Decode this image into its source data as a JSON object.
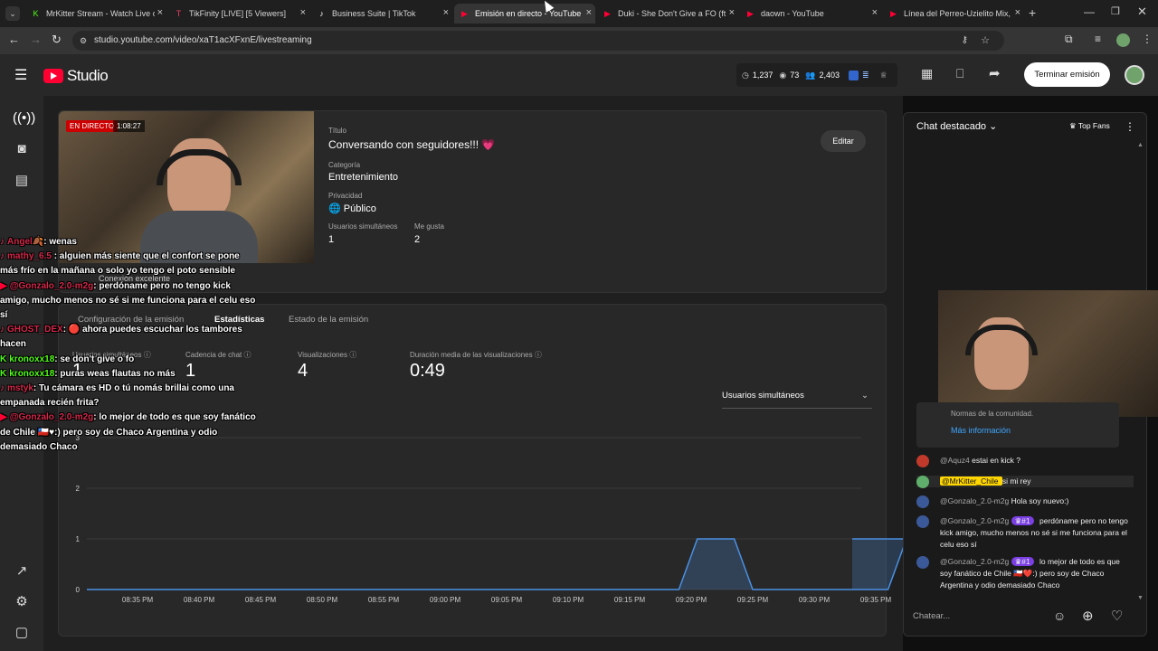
{
  "browser": {
    "tabs": [
      {
        "title": "MrKitter Stream - Watch Live o",
        "icon_color": "#53fc18",
        "icon": "K"
      },
      {
        "title": "TikFinity [LIVE] [5 Viewers]",
        "icon_color": "#e93c5e",
        "icon": "T"
      },
      {
        "title": "Business Suite | TikTok",
        "icon_color": "#ffffff",
        "icon": "♪"
      },
      {
        "title": "Emisión en directo - YouTube S",
        "icon_color": "#ff0033",
        "icon": "▶"
      },
      {
        "title": "Duki - She Don't Give a FO (ft.",
        "icon_color": "#ff0033",
        "icon": "▶"
      },
      {
        "title": "daown - YouTube",
        "icon_color": "#ff0033",
        "icon": "▶"
      },
      {
        "title": "Línea del Perreo-Uzielito Mix, V",
        "icon_color": "#ff0033",
        "icon": "▶"
      }
    ],
    "url": "studio.youtube.com/video/xaT1acXFxnE/livestreaming"
  },
  "header": {
    "logo_text": "Studio",
    "stats": {
      "likes": "1,237",
      "views": "73",
      "subs": "2,403"
    },
    "end_button": "Terminar emisión"
  },
  "stream": {
    "live_badge": "EN DIRECTO",
    "duration": "1:08:27",
    "title_label": "Título",
    "title": "Conversando con seguidores!!! 💗",
    "category_label": "Categoría",
    "category": "Entretenimiento",
    "privacy_label": "Privacidad",
    "privacy": "Público",
    "concurrent_label": "Usuarios simultáneos",
    "concurrent": "1",
    "likes_label": "Me gusta",
    "likes": "2",
    "edit_button": "Editar",
    "connection": "Conexión excelente"
  },
  "tabs": {
    "settings": "Configuración de la emisión",
    "stats": "Estadísticas",
    "health": "Estado de la emisión"
  },
  "stats": {
    "concurrent_label": "Usuarios simultáneos",
    "concurrent_value": "1",
    "chat_rate_label": "Cadencia de chat",
    "chat_rate_value": "1",
    "views_label": "Visualizaciones",
    "views_value": "4",
    "avg_duration_label": "Duración media de las visualizaciones",
    "avg_duration_value": "0:49",
    "dropdown": "Usuarios simultáneos"
  },
  "chart_data": {
    "type": "area",
    "x": [
      "08:35 PM",
      "08:40 PM",
      "08:45 PM",
      "08:50 PM",
      "08:55 PM",
      "09:00 PM",
      "09:05 PM",
      "09:10 PM",
      "09:15 PM",
      "09:20 PM",
      "09:25 PM",
      "09:30 PM",
      "09:35 PM"
    ],
    "yticks": [
      0,
      1,
      2,
      3
    ],
    "ylim": [
      0,
      3.5
    ],
    "series": [
      {
        "points": [
          [
            0,
            0
          ],
          [
            8.9,
            0
          ],
          [
            9.2,
            1
          ],
          [
            9.8,
            1
          ],
          [
            10.1,
            0
          ],
          [
            12.3,
            0
          ],
          [
            12.6,
            1
          ],
          [
            13,
            1
          ]
        ]
      }
    ],
    "line_color": "#4a90e2"
  },
  "chat": {
    "header": "Chat destacado",
    "top_fans": "Top Fans",
    "more_info": "Más información",
    "community_note": "Normas de la comunidad.",
    "messages": [
      {
        "author": "@Aquz4",
        "text": "estai en kick ?",
        "color": "#c0392b"
      },
      {
        "author": "@MrKitter_Chile",
        "text": "si mi rey",
        "color": "#5fae6b",
        "highlight": true
      },
      {
        "author": "@Gonzalo_2.0-m2g",
        "text": "Hola soy nuevo:)",
        "color": "#3b5998"
      },
      {
        "author": "@Gonzalo_2.0-m2g",
        "badge": "#1",
        "text": "perdóname pero no tengo kick amigo, mucho menos no sé si me funciona para el celu eso sí",
        "color": "#3b5998"
      },
      {
        "author": "@Gonzalo_2.0-m2g",
        "badge": "#1",
        "text": "lo mejor de todo es que soy fanático de Chile 🇨🇱❤️:) pero soy de Chaco Argentina y odio demasiado Chaco",
        "color": "#3b5998"
      }
    ],
    "input_placeholder": "Chatear..."
  },
  "overlay": [
    {
      "user": "Angel🍂",
      "text": ": wenas",
      "platform": "tiktok"
    },
    {
      "user": "mathy_6.5 ",
      "text": ": alguien más siente que el confort se pone",
      "platform": "tiktok"
    },
    {
      "user": "",
      "text": "más frío en la mañana o solo yo tengo el poto sensible",
      "platform": "none"
    },
    {
      "user": "@Gonzalo_2.0-m2g",
      "text": ": perdóname pero no tengo kick",
      "platform": "youtube"
    },
    {
      "user": "",
      "text": "amigo, mucho menos no sé si me funciona para el celu eso",
      "platform": "none"
    },
    {
      "user": "",
      "text": "sí",
      "platform": "none"
    },
    {
      "user": "GHOST_DEX",
      "text": ": 🔴 ahora puedes escuchar los tambores",
      "platform": "tiktok"
    },
    {
      "user": "",
      "text": "hacen",
      "platform": "none"
    },
    {
      "user": "kronoxx18",
      "text": ": se don't give o fo",
      "platform": "kick"
    },
    {
      "user": "kronoxx18",
      "text": ": puras weas flautas no más",
      "platform": "kick"
    },
    {
      "user": "mstyk",
      "text": ": Tu cámara es HD o tú nomás brillai como una",
      "platform": "tiktok"
    },
    {
      "user": "",
      "text": "empanada recién frita?",
      "platform": "none"
    },
    {
      "user": "@Gonzalo_2.0-m2g",
      "text": ": lo mejor de todo es que soy fanático",
      "platform": "youtube"
    },
    {
      "user": "",
      "text": "de Chile 🇨🇱♥:) pero soy de Chaco Argentina y odio",
      "platform": "none"
    },
    {
      "user": "",
      "text": "demasiado Chaco",
      "platform": "none"
    }
  ]
}
